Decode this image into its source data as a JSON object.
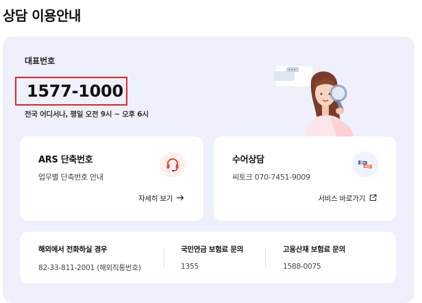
{
  "page": {
    "title": "상담 이용안내"
  },
  "representative": {
    "label": "대표번호",
    "number": "1577-1000",
    "hours": "전국 어디서나, 평일 오전 9시 ~ 오후 6시"
  },
  "cards": {
    "ars": {
      "title": "ARS 단축번호",
      "description": "업무별 단축번호 안내",
      "link_label": "자세히 보기",
      "icon": "headset-icon"
    },
    "sign": {
      "title": "수어상담",
      "description": "씨토크 070-7451-9009",
      "link_label": "서비스 바로가기",
      "icon": "sign-language-icon"
    }
  },
  "info": [
    {
      "title": "해외에서 전화하실 경우",
      "value": "82-33-811-2001 (해외직통번호)"
    },
    {
      "title": "국민연금 보험료 문의",
      "value": "1355"
    },
    {
      "title": "고용산재 보험료 문의",
      "value": "1588-0075"
    }
  ],
  "colors": {
    "panel_bg": "#eef1fb",
    "highlight_border": "#e52222",
    "ars_icon_accent": "#e8452c"
  }
}
